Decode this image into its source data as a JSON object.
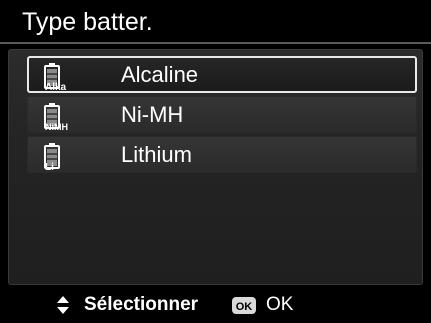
{
  "title": "Type batter.",
  "battery_types": [
    {
      "label": "Alcaline",
      "icon": "battery-alkaline-icon",
      "badge": "Alka",
      "selected": true
    },
    {
      "label": "Ni-MH",
      "icon": "battery-nimh-icon",
      "badge": "NiMH",
      "selected": false
    },
    {
      "label": "Lithium",
      "icon": "battery-lithium-icon",
      "badge": "Li",
      "selected": false
    }
  ],
  "footer": {
    "nav_icon": "up-down-arrows-icon",
    "nav_label": "Sélectionner",
    "ok_icon": "ok-button-icon",
    "ok_icon_text": "OK",
    "ok_label": "OK"
  },
  "colors": {
    "background": "#000000",
    "panel": "#262626",
    "item": "#303030",
    "selection_border": "#e9e9e9",
    "text": "#ffffff"
  }
}
